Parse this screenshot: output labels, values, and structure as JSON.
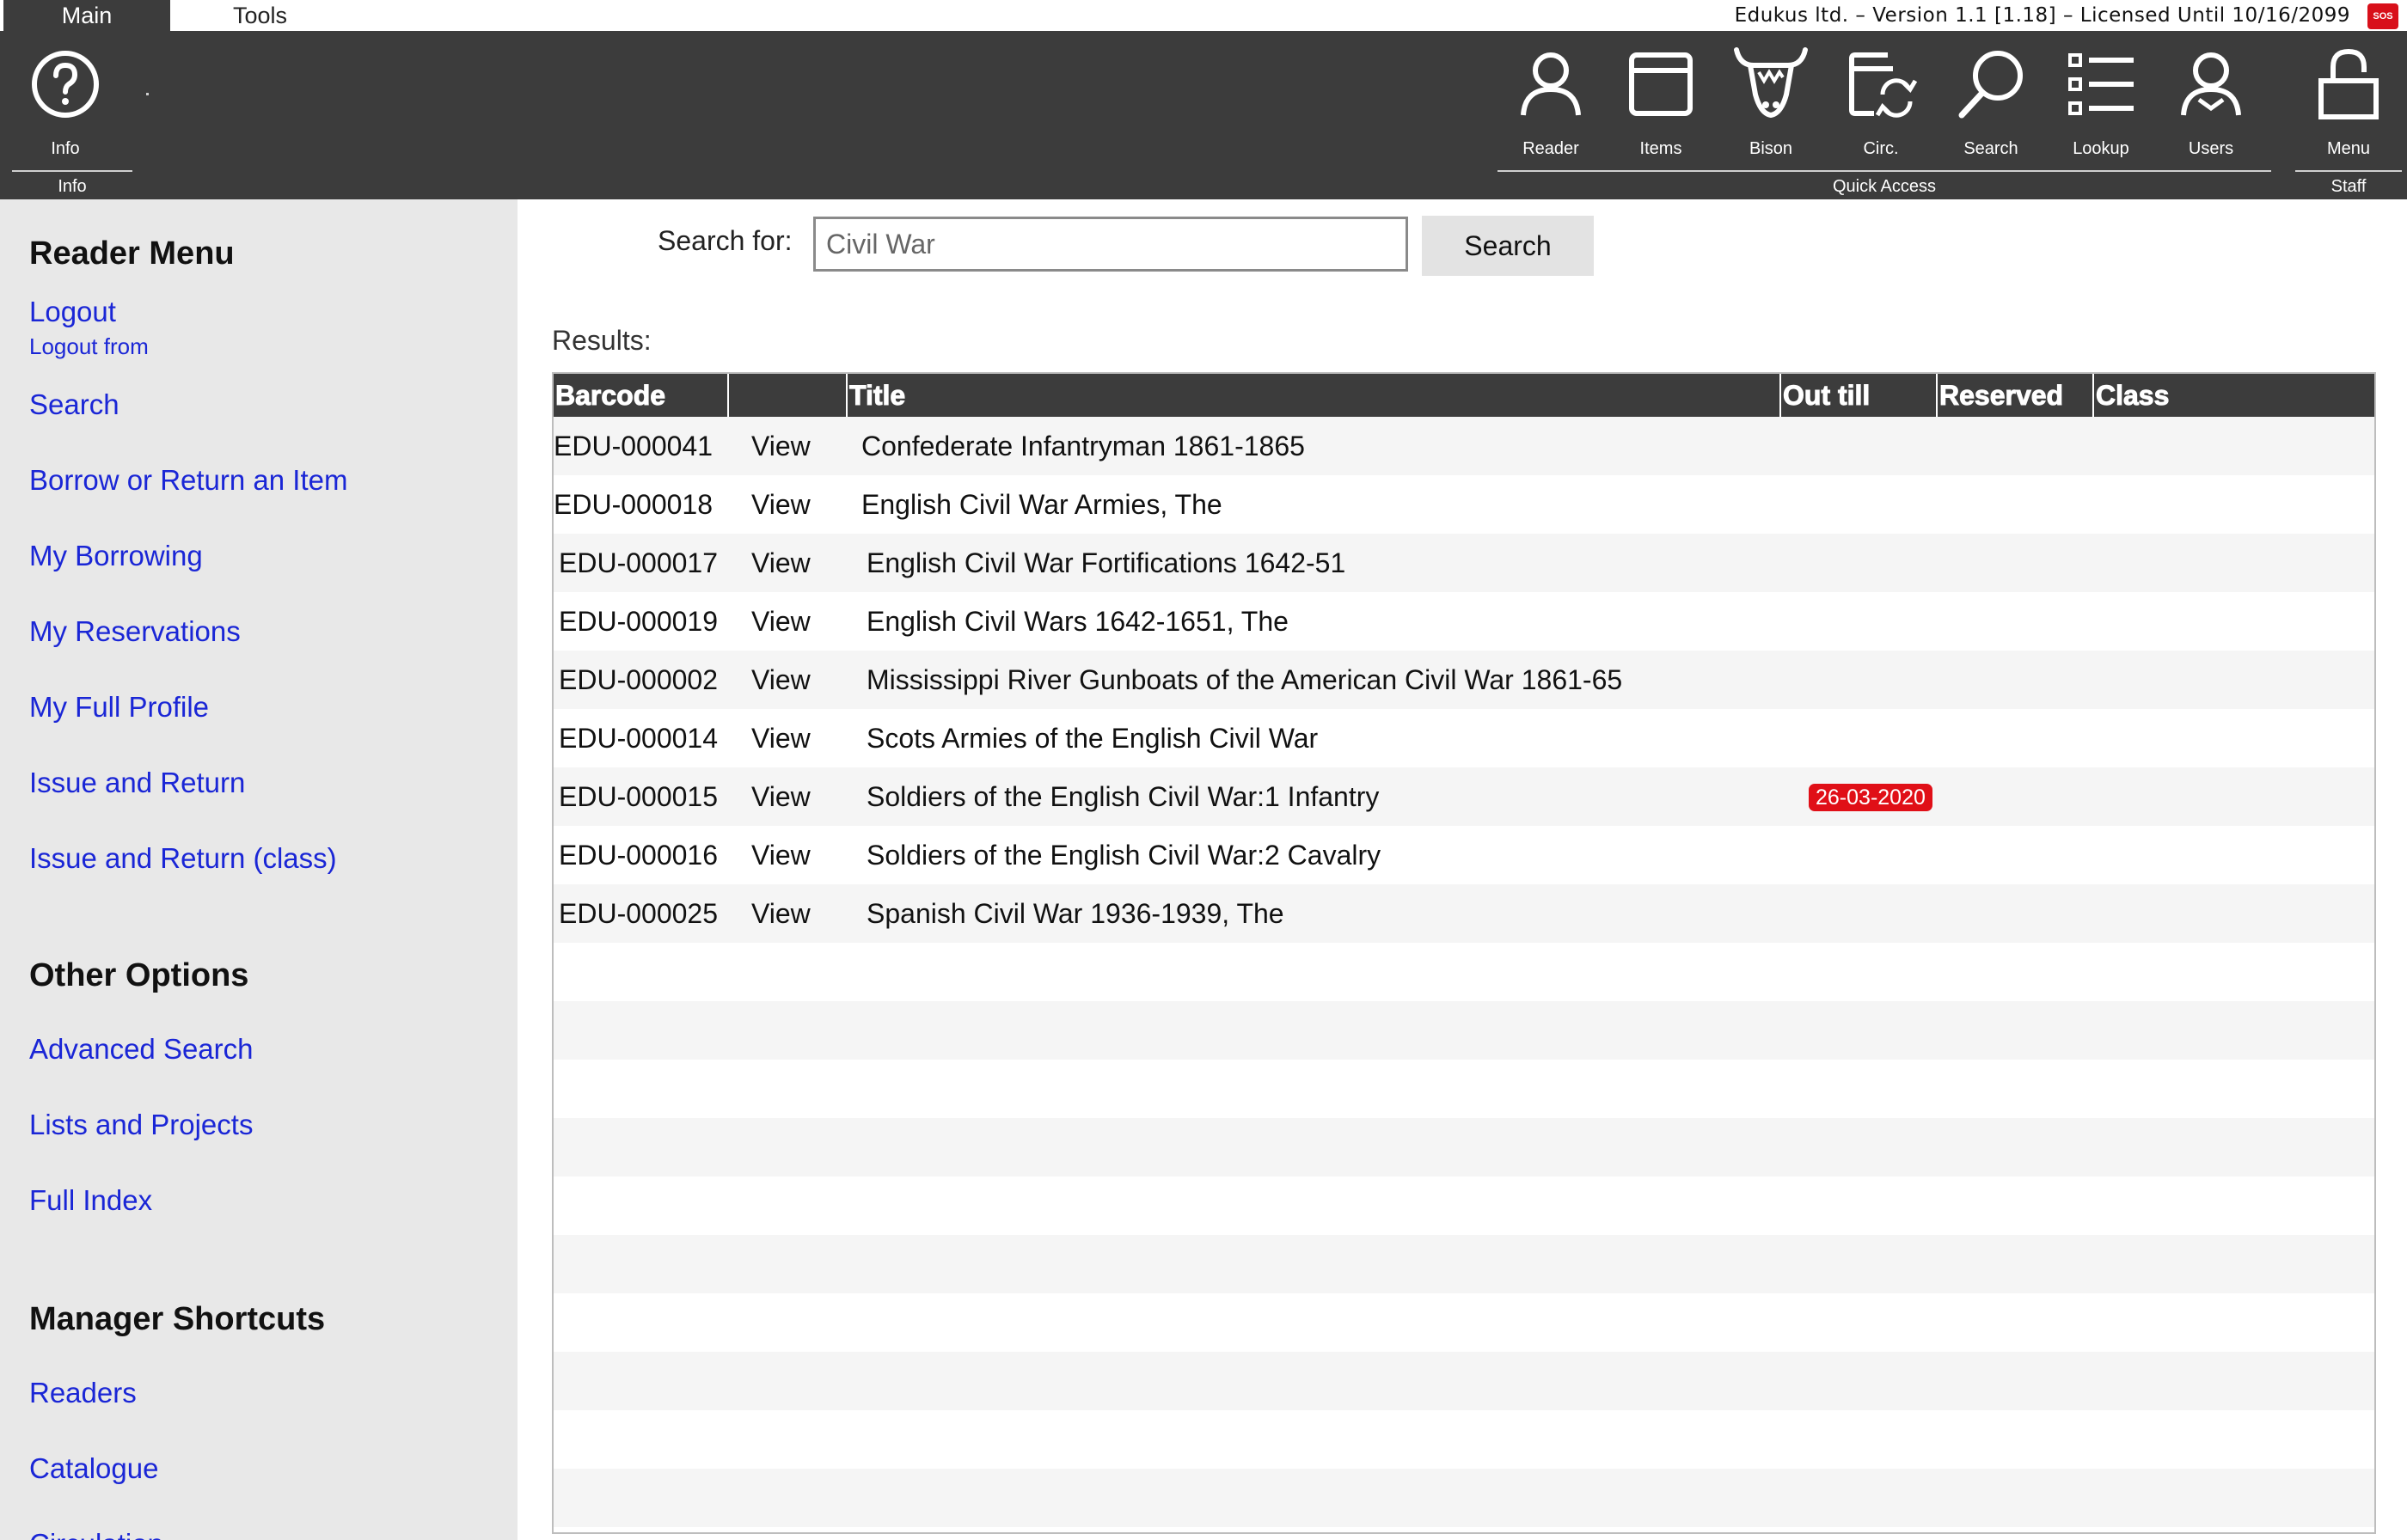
{
  "tabs": [
    {
      "label": "Main",
      "active": true
    },
    {
      "label": "Tools",
      "active": false
    }
  ],
  "version_text": "Edukus ltd. – Version 1.1 [1.18] – Licensed Until 10/16/2099",
  "sos_label": "SOS",
  "toolbar": {
    "info": {
      "label": "Info",
      "icon": "question-circle-icon"
    },
    "quick_access": [
      {
        "label": "Reader",
        "icon": "person-icon"
      },
      {
        "label": "Items",
        "icon": "window-icon"
      },
      {
        "label": "Bison",
        "icon": "bison-icon"
      },
      {
        "label": "Circ.",
        "icon": "circulation-icon"
      },
      {
        "label": "Search",
        "icon": "search-icon"
      },
      {
        "label": "Lookup",
        "icon": "list-icon"
      },
      {
        "label": "Users",
        "icon": "users-icon"
      }
    ],
    "menu": {
      "label": "Menu",
      "icon": "lock-icon"
    },
    "groups": {
      "info": "Info",
      "quick_access": "Quick Access",
      "staff": "Staff"
    }
  },
  "sidebar": {
    "reader_menu": {
      "heading": "Reader Menu",
      "logout": "Logout",
      "logout_sub": "Logout from",
      "items": [
        "Search",
        "Borrow or Return an Item",
        "My Borrowing",
        "My Reservations",
        "My Full Profile",
        "Issue and Return",
        "Issue and Return (class)"
      ]
    },
    "other_options": {
      "heading": "Other Options",
      "items": [
        "Advanced Search",
        "Lists and Projects",
        "Full Index"
      ]
    },
    "manager_shortcuts": {
      "heading": "Manager Shortcuts",
      "items": [
        "Readers",
        "Catalogue",
        "Circulation"
      ]
    }
  },
  "search": {
    "label": "Search for:",
    "value": "Civil War",
    "button": "Search"
  },
  "results": {
    "label": "Results:",
    "columns": [
      "Barcode",
      "",
      "Title",
      "Out till",
      "Reserved",
      "Class"
    ],
    "rows": [
      {
        "barcode": "EDU-000041",
        "view": "View",
        "title": "Confederate Infantryman 1861-1865",
        "reserved": ""
      },
      {
        "barcode": "EDU-000018",
        "view": "View",
        "title": "English Civil War Armies, The",
        "reserved": ""
      },
      {
        "barcode": "EDU-000017",
        "view": "View",
        "title": "English Civil War Fortifications 1642-51",
        "reserved": ""
      },
      {
        "barcode": "EDU-000019",
        "view": "View",
        "title": "English Civil Wars 1642-1651, The",
        "reserved": ""
      },
      {
        "barcode": "EDU-000002",
        "view": "View",
        "title": "Mississippi River Gunboats of the American Civil War 1861-65",
        "reserved": ""
      },
      {
        "barcode": "EDU-000014",
        "view": "View",
        "title": "Scots Armies of the English Civil War",
        "reserved": ""
      },
      {
        "barcode": "EDU-000015",
        "view": "View",
        "title": "Soldiers of the English Civil War:1 Infantry",
        "reserved": "26-03-2020"
      },
      {
        "barcode": "EDU-000016",
        "view": "View",
        "title": "Soldiers of the English Civil War:2 Cavalry",
        "reserved": ""
      },
      {
        "barcode": "EDU-000025",
        "view": "View",
        "title": "Spanish Civil War 1936-1939, The",
        "reserved": ""
      }
    ]
  },
  "colors": {
    "toolbar_bg": "#3c3c3c",
    "sidebar_bg": "#e8e8e8",
    "link": "#1a26d6",
    "badge": "#e00f17"
  }
}
